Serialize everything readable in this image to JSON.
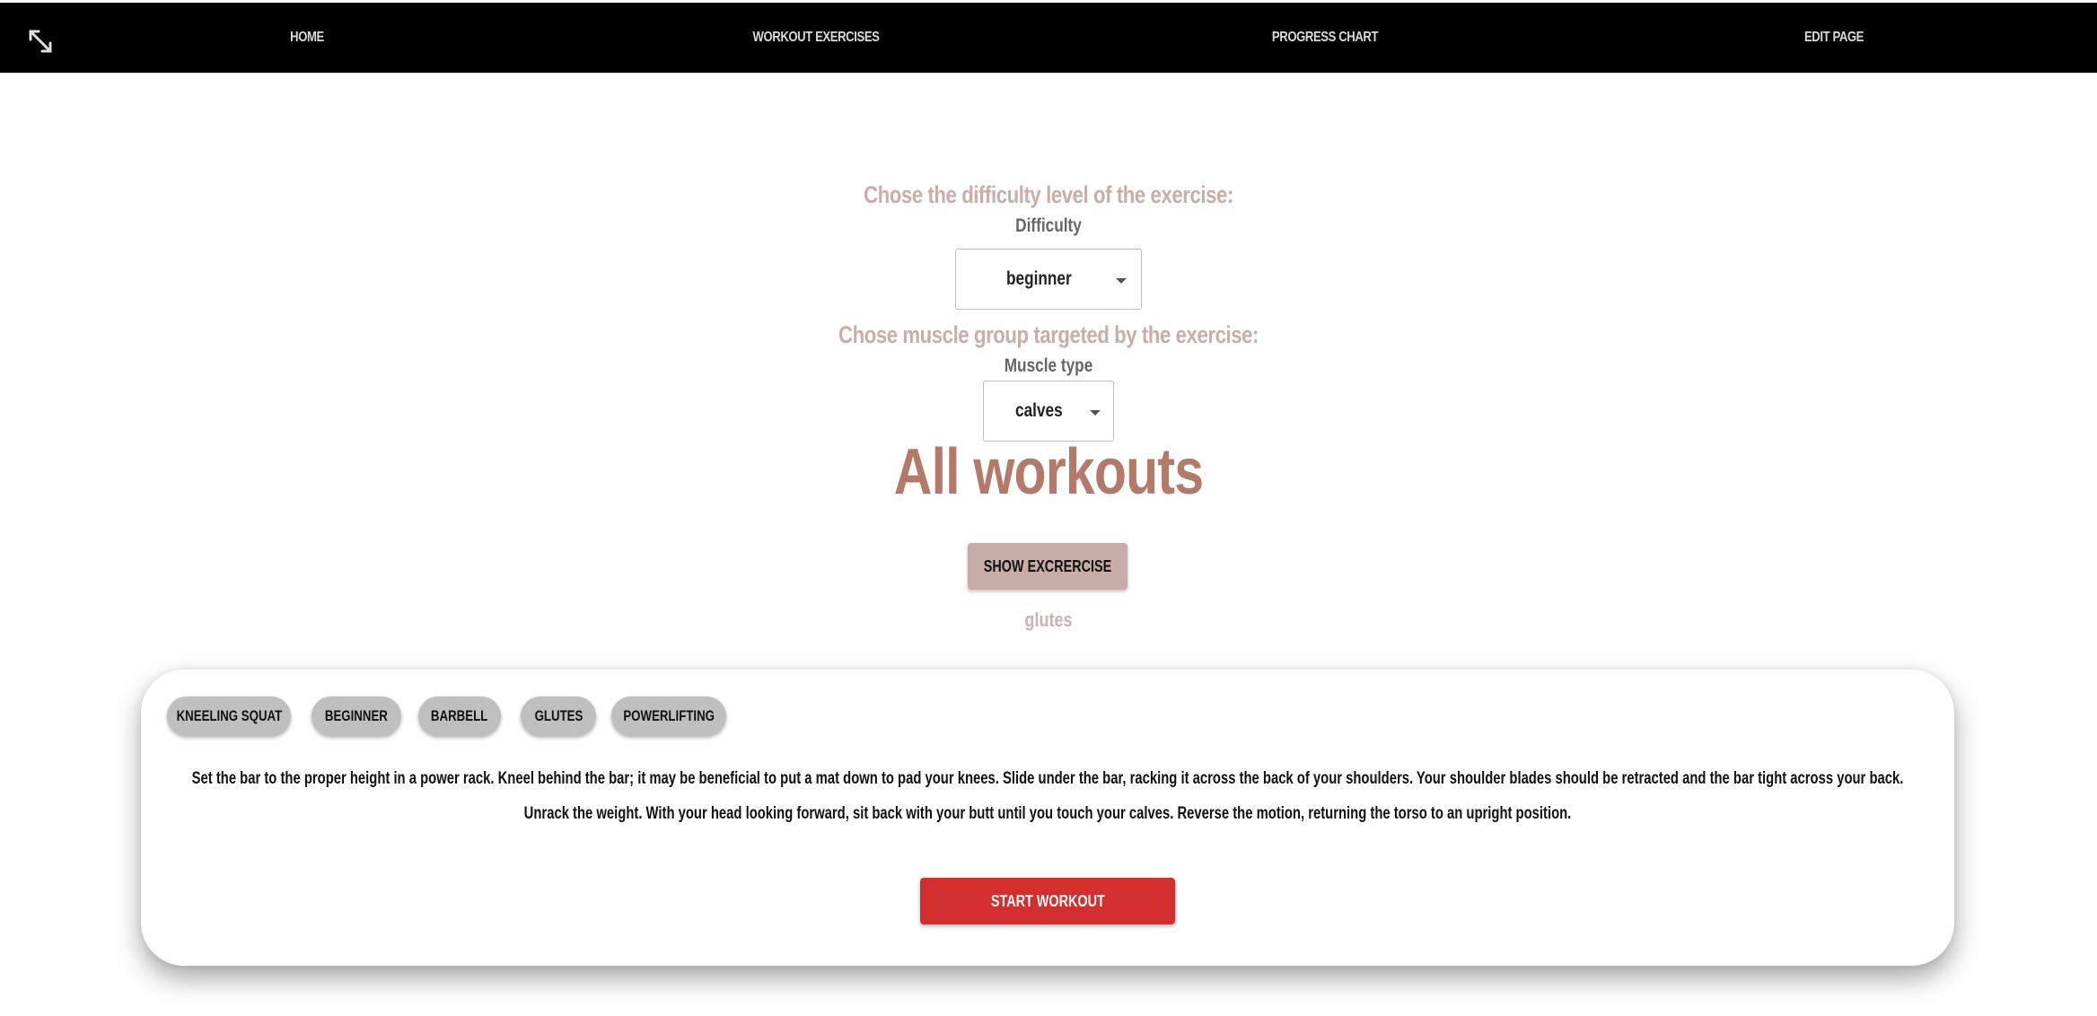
{
  "nav": {
    "logo_icon": "expand-arrows-icon",
    "items": [
      {
        "label": "HOME"
      },
      {
        "label": "WORKOUT EXERCISES"
      },
      {
        "label": "PROGRESS CHART"
      },
      {
        "label": "EDIT PAGE"
      }
    ]
  },
  "difficulty": {
    "heading": "Chose the difficulty level of the exercise:",
    "label": "Difficulty",
    "value": "beginner"
  },
  "muscle": {
    "heading": "Chose muscle group targeted by the exercise:",
    "label": "Muscle type",
    "value": "calves"
  },
  "main": {
    "title": "All workouts",
    "show_button": "SHOW EXCRERCISE",
    "result_muscle": "glutes"
  },
  "exercise": {
    "tags": [
      {
        "label": "KNEELING SQUAT"
      },
      {
        "label": "BEGINNER"
      },
      {
        "label": "BARBELL"
      },
      {
        "label": "GLUTES"
      },
      {
        "label": "POWERLIFTING"
      }
    ],
    "description": "Set the bar to the proper height in a power rack. Kneel behind the bar; it may be beneficial to put a mat down to pad your knees. Slide under the bar, racking it across the back of your shoulders. Your shoulder blades should be retracted and the bar tight across your back. Unrack the weight. With your head looking forward, sit back with your butt until you touch your calves. Reverse the motion, returning the torso to an upright position.",
    "start_button": "START WORKOUT"
  },
  "colors": {
    "nav_bg": "#000000",
    "heading": "#c8ada8",
    "title": "#b37a6a",
    "show_button_bg": "#c7aca7",
    "start_button_bg": "#d32f2f",
    "chip_bg": "#bfbfbf"
  }
}
